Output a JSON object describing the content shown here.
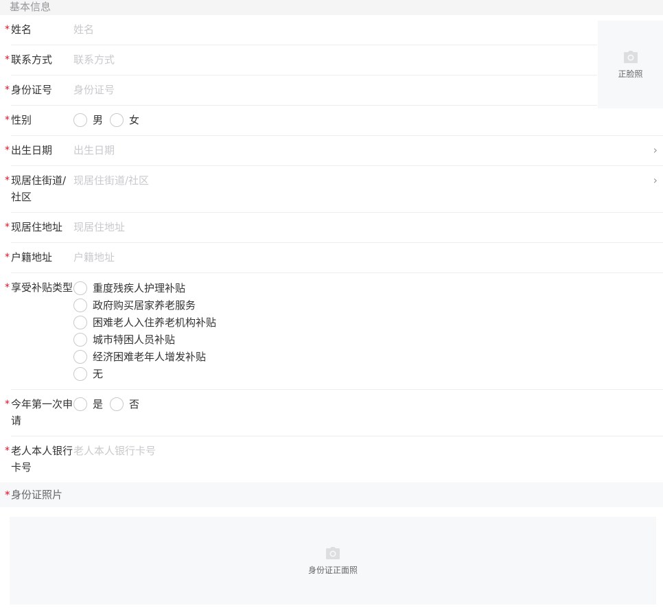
{
  "section_basic": "基本信息",
  "photo": {
    "caption": "正脸照",
    "icon": "camera-icon"
  },
  "fields": {
    "name": {
      "label": "姓名",
      "placeholder": "姓名"
    },
    "contact": {
      "label": "联系方式",
      "placeholder": "联系方式"
    },
    "id_number": {
      "label": "身份证号",
      "placeholder": "身份证号"
    },
    "gender": {
      "label": "性别",
      "options": [
        "男",
        "女"
      ]
    },
    "birth_date": {
      "label": "出生日期",
      "placeholder": "出生日期"
    },
    "street": {
      "label": "现居住街道/社区",
      "placeholder": "现居住街道/社区"
    },
    "address": {
      "label": "现居住地址",
      "placeholder": "现居住地址"
    },
    "household_address": {
      "label": "户籍地址",
      "placeholder": "户籍地址"
    },
    "subsidy_type": {
      "label": "享受补贴类型",
      "options": [
        "重度残疾人护理补贴",
        "政府购买居家养老服务",
        "困难老人入住养老机构补贴",
        "城市特困人员补贴",
        "经济困难老年人增发补贴",
        "无"
      ]
    },
    "first_apply": {
      "label": "今年第一次申请",
      "options": [
        "是",
        "否"
      ]
    },
    "bank_card": {
      "label": "老人本人银行卡号",
      "placeholder": "老人本人银行卡号"
    }
  },
  "required_mark": "*",
  "arrow_glyph": "›",
  "section_id_photo": "身份证照片",
  "id_upload": {
    "caption": "身份证正面照",
    "icon": "camera-icon"
  },
  "colors": {
    "required": "#ee0a24",
    "placeholder": "#c8c9cc",
    "section_bg": "#f5f5f5"
  }
}
